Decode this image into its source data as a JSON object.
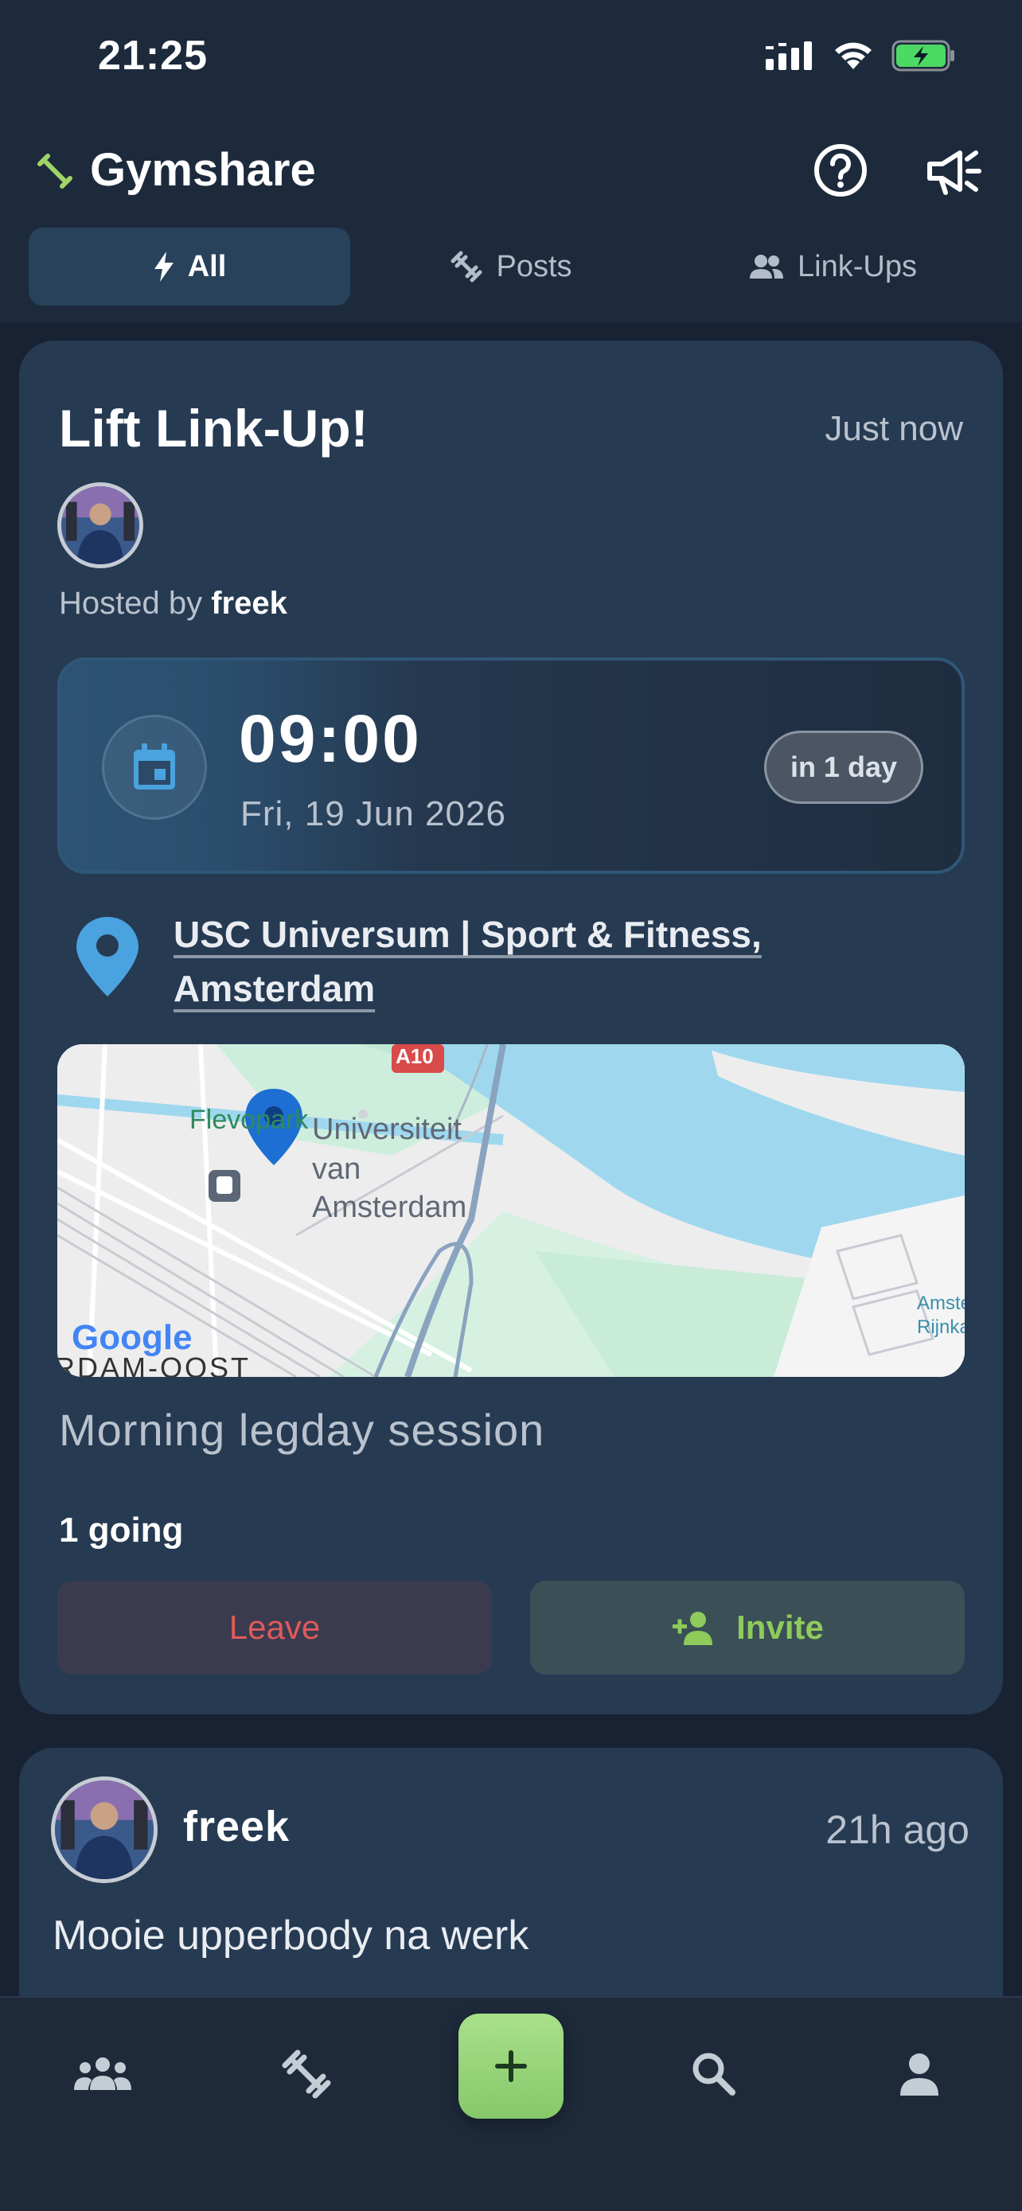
{
  "status_bar": {
    "time": "21:25"
  },
  "app": {
    "title": "Gymshare"
  },
  "tabs": [
    {
      "label": "All",
      "icon": "bolt-icon",
      "active": true
    },
    {
      "label": "Posts",
      "icon": "dumbbell-icon",
      "active": false
    },
    {
      "label": "Link-Ups",
      "icon": "people-icon",
      "active": false
    }
  ],
  "linkup": {
    "title": "Lift Link-Up!",
    "time_ago": "Just now",
    "hosted_prefix": "Hosted by ",
    "host": "freek",
    "time": "09:00",
    "date": "Fri, 19 Jun 2026",
    "relative": "in 1 day",
    "location": "USC Universum | Sport & Fitness, Amsterdam",
    "map": {
      "labels": [
        "Flevopark",
        "Universiteit",
        "van",
        "Amsterdam",
        "A10",
        "Amster",
        "Rijnka",
        "RDAM-OOST",
        "Google"
      ]
    },
    "description": "Morning legday session",
    "going": "1 going",
    "leave_label": "Leave",
    "invite_label": "Invite"
  },
  "post": {
    "author": "freek",
    "time_ago": "21h ago",
    "text": "Mooie upperbody na werk"
  },
  "colors": {
    "background": "#182233",
    "card": "#263a52",
    "accent_green": "#8fca5b",
    "leave_red": "#e05a5a",
    "pin_blue": "#4aa3df"
  }
}
